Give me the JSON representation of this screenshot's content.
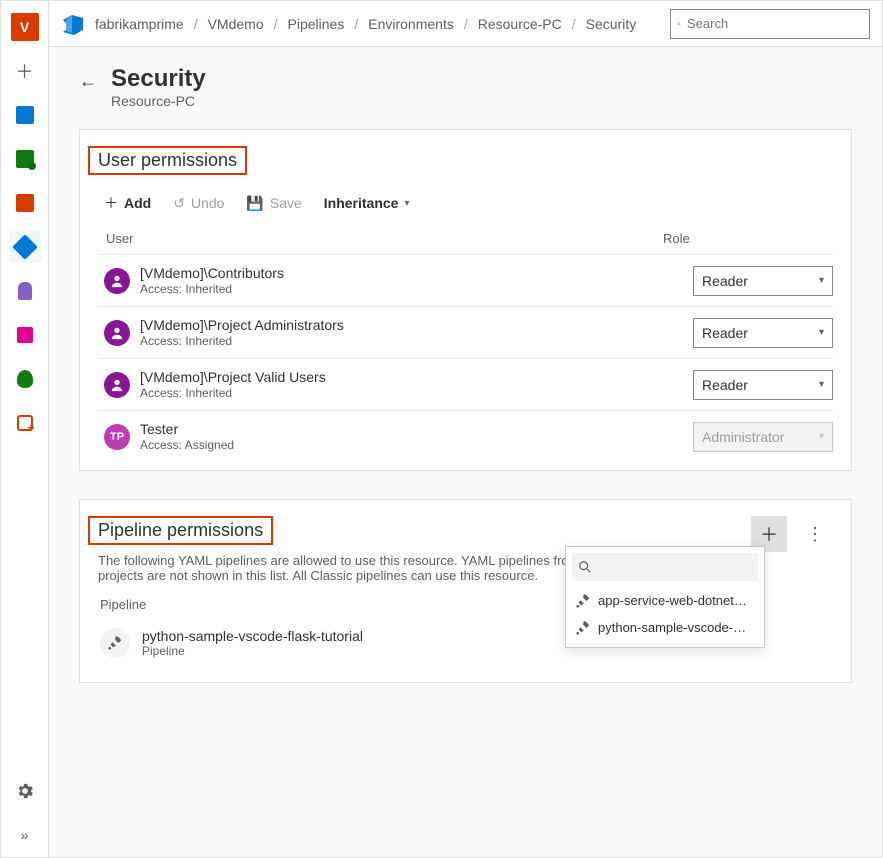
{
  "breadcrumb": {
    "items": [
      "fabrikamprime",
      "VMdemo",
      "Pipelines",
      "Environments",
      "Resource-PC",
      "Security"
    ],
    "separator": "/"
  },
  "search": {
    "placeholder": "Search"
  },
  "rail": {
    "project_initial": "V",
    "settings_title": "Project settings",
    "expand_title": "Expand"
  },
  "header": {
    "title": "Security",
    "subtitle": "Resource-PC"
  },
  "user_permissions": {
    "section_title": "User permissions",
    "toolbar": {
      "add": "Add",
      "undo": "Undo",
      "save": "Save",
      "inheritance": "Inheritance"
    },
    "cols": {
      "user": "User",
      "role": "Role"
    },
    "rows": [
      {
        "name": "[VMdemo]\\Contributors",
        "access": "Access: Inherited",
        "role": "Reader",
        "type": "group",
        "disabled": false
      },
      {
        "name": "[VMdemo]\\Project Administrators",
        "access": "Access: Inherited",
        "role": "Reader",
        "type": "group",
        "disabled": false
      },
      {
        "name": "[VMdemo]\\Project Valid Users",
        "access": "Access: Inherited",
        "role": "Reader",
        "type": "group",
        "disabled": false
      },
      {
        "name": "Tester",
        "access": "Access: Assigned",
        "role": "Administrator",
        "type": "user",
        "initials": "TP",
        "disabled": true
      }
    ]
  },
  "pipeline_permissions": {
    "section_title": "Pipeline permissions",
    "description": "The following YAML pipelines are allowed to use this resource. YAML pipelines from other projects are not shown in this list. All Classic pipelines can use this resource.",
    "col_label": "Pipeline",
    "pipeline": {
      "name": "python-sample-vscode-flask-tutorial",
      "kind": "Pipeline"
    },
    "dropdown": {
      "options": [
        "app-service-web-dotnet…",
        "python-sample-vscode-…"
      ]
    }
  }
}
